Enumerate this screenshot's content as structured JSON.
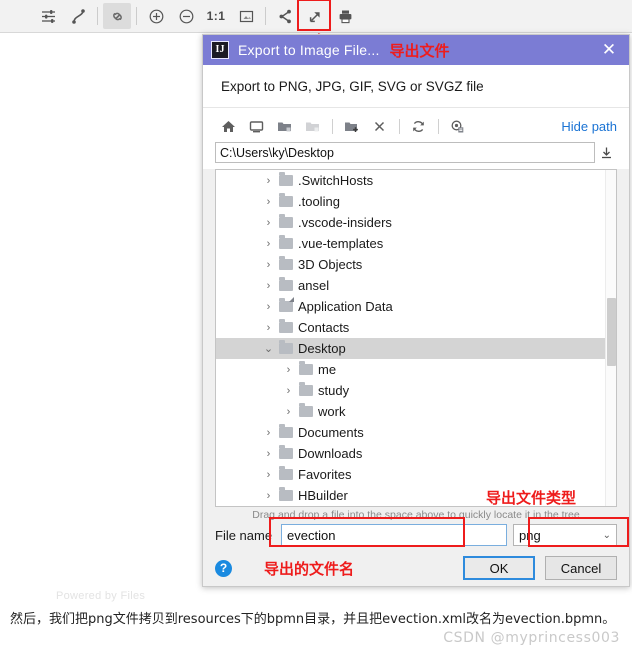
{
  "toolbar": {
    "buttons": [
      {
        "name": "settings-sliders-icon",
        "glyph": "settings",
        "active": false
      },
      {
        "name": "curve-connector-icon",
        "glyph": "curve",
        "active": false
      },
      {
        "name": "link-attach-icon",
        "glyph": "link",
        "active": true
      },
      {
        "name": "zoom-in-icon",
        "glyph": "plus-circle",
        "active": false
      },
      {
        "name": "zoom-out-icon",
        "glyph": "minus-circle",
        "active": false
      },
      {
        "name": "zoom-actual-size-icon",
        "glyph": "1:1",
        "active": false
      },
      {
        "name": "fit-to-screen-icon",
        "glyph": "fit",
        "active": false
      },
      {
        "name": "share-icon",
        "glyph": "share",
        "active": false
      },
      {
        "name": "export-image-icon",
        "glyph": "export",
        "active": false,
        "highlighted": true
      },
      {
        "name": "print-icon",
        "glyph": "print",
        "active": false
      }
    ],
    "zoom_actual_label": "1:1"
  },
  "dialog": {
    "title": "Export to Image File...",
    "title_annotation": "导出文件",
    "close_label": "✕",
    "subtitle": "Export to PNG, JPG, GIF, SVG or SVGZ file",
    "path_toolbar": {
      "buttons": [
        {
          "name": "home-icon",
          "glyph": "home",
          "dim": false
        },
        {
          "name": "desktop-icon",
          "glyph": "desktop",
          "dim": false
        },
        {
          "name": "folder-expand-icon",
          "glyph": "folder-dot",
          "dim": false
        },
        {
          "name": "folder-collapse-icon",
          "glyph": "folder-dot",
          "dim": true
        },
        {
          "name": "new-folder-icon",
          "glyph": "folder-plus",
          "dim": false
        },
        {
          "name": "delete-icon",
          "glyph": "x",
          "dim": false
        },
        {
          "name": "refresh-icon",
          "glyph": "refresh",
          "dim": false
        },
        {
          "name": "show-hidden-files-icon",
          "glyph": "hidden",
          "dim": false
        }
      ],
      "hide_path_label": "Hide path"
    },
    "path_value": "C:\\Users\\ky\\Desktop",
    "tree": [
      {
        "label": ".SwitchHosts",
        "indent": 0,
        "chev": "›",
        "expanded": false,
        "selected": false,
        "shortcut": false
      },
      {
        "label": ".tooling",
        "indent": 0,
        "chev": "›",
        "expanded": false,
        "selected": false,
        "shortcut": false
      },
      {
        "label": ".vscode-insiders",
        "indent": 0,
        "chev": "›",
        "expanded": false,
        "selected": false,
        "shortcut": false
      },
      {
        "label": ".vue-templates",
        "indent": 0,
        "chev": "›",
        "expanded": false,
        "selected": false,
        "shortcut": false
      },
      {
        "label": "3D Objects",
        "indent": 0,
        "chev": "›",
        "expanded": false,
        "selected": false,
        "shortcut": false
      },
      {
        "label": "ansel",
        "indent": 0,
        "chev": "›",
        "expanded": false,
        "selected": false,
        "shortcut": false
      },
      {
        "label": "Application Data",
        "indent": 0,
        "chev": "›",
        "expanded": false,
        "selected": false,
        "shortcut": true
      },
      {
        "label": "Contacts",
        "indent": 0,
        "chev": "›",
        "expanded": false,
        "selected": false,
        "shortcut": false
      },
      {
        "label": "Desktop",
        "indent": 0,
        "chev": "⌄",
        "expanded": true,
        "selected": true,
        "shortcut": false
      },
      {
        "label": "me",
        "indent": 1,
        "chev": "›",
        "expanded": false,
        "selected": false,
        "shortcut": false
      },
      {
        "label": "study",
        "indent": 1,
        "chev": "›",
        "expanded": false,
        "selected": false,
        "shortcut": false
      },
      {
        "label": "work",
        "indent": 1,
        "chev": "›",
        "expanded": false,
        "selected": false,
        "shortcut": false
      },
      {
        "label": "Documents",
        "indent": 0,
        "chev": "›",
        "expanded": false,
        "selected": false,
        "shortcut": false
      },
      {
        "label": "Downloads",
        "indent": 0,
        "chev": "›",
        "expanded": false,
        "selected": false,
        "shortcut": false
      },
      {
        "label": "Favorites",
        "indent": 0,
        "chev": "›",
        "expanded": false,
        "selected": false,
        "shortcut": false
      },
      {
        "label": "HBuilder",
        "indent": 0,
        "chev": "›",
        "expanded": false,
        "selected": false,
        "shortcut": false
      }
    ],
    "drag_hint": "Drag and drop a file into the space above to quickly locate it in the tree",
    "file_name_label": "File name",
    "file_name_value": "evection",
    "format_value": "png",
    "format_caret": "⌄",
    "help_label": "?",
    "ok_label": "OK",
    "cancel_label": "Cancel",
    "annotation_filetype": "导出文件类型",
    "annotation_filename": "导出的文件名"
  },
  "page": {
    "powered_by": "Powered by Files",
    "body_text": "然后，我们把png文件拷贝到resources下的bpmn目录，并且把evection.xml改名为evection.bpmn。",
    "watermark": "CSDN @myprincess003"
  },
  "colors": {
    "title_bar": "#7b7cd4",
    "annotation_red": "#ee1c1c",
    "link_blue": "#1a73d4",
    "focus_blue": "#2e8bdd",
    "selection_gray": "#d4d4d4"
  }
}
